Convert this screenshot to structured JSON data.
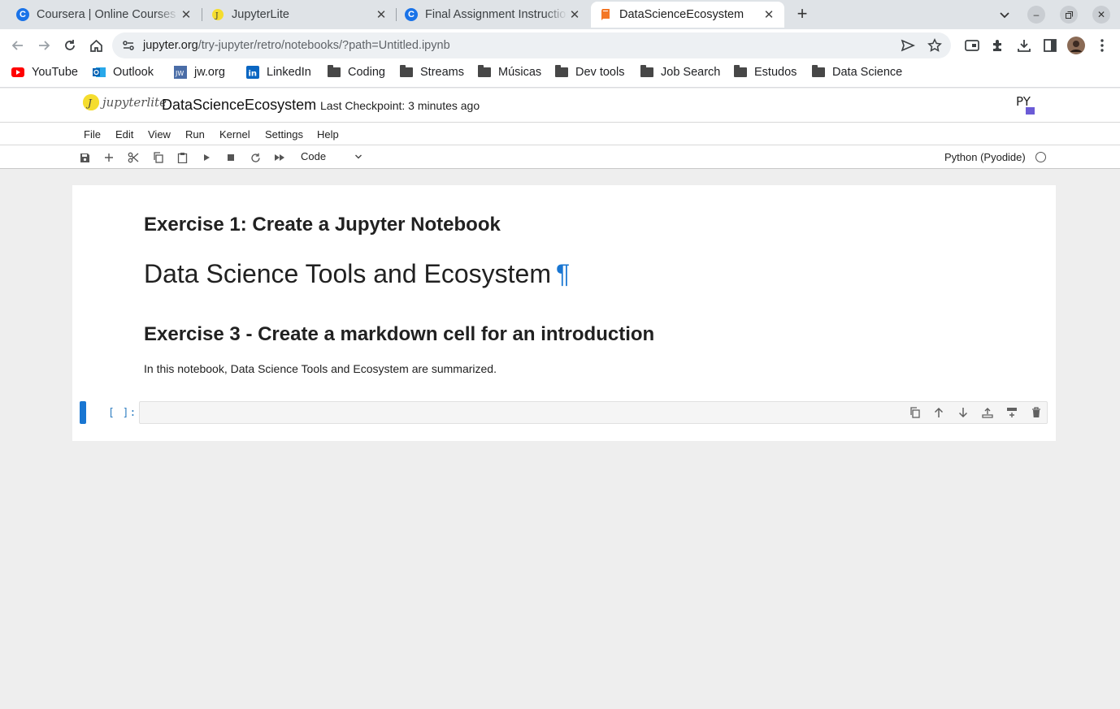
{
  "browser": {
    "tabs": [
      {
        "title": "Coursera | Online Courses & Credentials From Top Educators",
        "favicon": "coursera-icon",
        "active": false
      },
      {
        "title": "JupyterLite",
        "favicon": "jupyterlite-icon",
        "active": false
      },
      {
        "title": "Final Assignment Instructions",
        "favicon": "coursera-icon",
        "active": false
      },
      {
        "title": "DataScienceEcosystem",
        "favicon": "notebook-icon",
        "active": true
      }
    ],
    "url_host": "jupyter.org",
    "url_path": "/try-jupyter/retro/notebooks/?path=Untitled.ipynb",
    "bookmarks": [
      {
        "label": "YouTube",
        "icon": "youtube-icon"
      },
      {
        "label": "Outlook",
        "icon": "outlook-icon"
      },
      {
        "label": "jw.org",
        "icon": "jw-icon"
      },
      {
        "label": "LinkedIn",
        "icon": "linkedin-icon"
      },
      {
        "label": "Coding",
        "icon": "folder-icon"
      },
      {
        "label": "Streams",
        "icon": "folder-icon"
      },
      {
        "label": "Músicas",
        "icon": "folder-icon"
      },
      {
        "label": "Dev tools",
        "icon": "folder-icon"
      },
      {
        "label": "Job Search",
        "icon": "folder-icon"
      },
      {
        "label": "Estudos",
        "icon": "folder-icon"
      },
      {
        "label": "Data Science",
        "icon": "folder-icon"
      }
    ]
  },
  "jupyter": {
    "logo_text": "jupyterlite",
    "notebook_title": "DataScienceEcosystem",
    "checkpoint": "Last Checkpoint: 3 minutes ago",
    "menu": [
      "File",
      "Edit",
      "View",
      "Run",
      "Kernel",
      "Settings",
      "Help"
    ],
    "cell_type": "Code",
    "kernel_name": "Python (Pyodide)",
    "accent": "#1976d2"
  },
  "cells": {
    "heading1": "Exercise 1: Create a Jupyter Notebook",
    "heading2": "Data Science Tools and Ecosystem",
    "heading2_anchor": "¶",
    "heading3": "Exercise 3 - Create a markdown cell for an introduction",
    "paragraph": "In this notebook, Data Science Tools and Ecosystem are summarized.",
    "prompt": "[ ]:"
  }
}
